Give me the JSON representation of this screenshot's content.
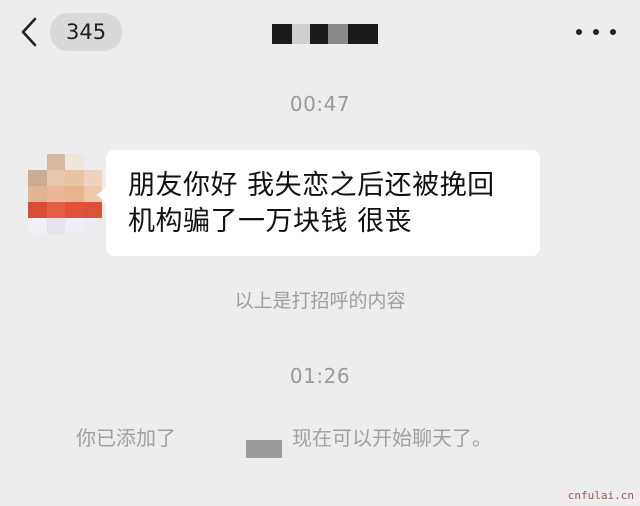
{
  "header": {
    "back_icon": "chevron-left-icon",
    "unread_count": "345",
    "title": "",
    "more_icon": "ellipsis-icon",
    "title_mosaic_colors": [
      "#1a1a1a",
      "#cfcfcf",
      "#1a1a1a",
      "#8a8a8a",
      "#1a1a1a"
    ]
  },
  "messages": [
    {
      "time": "00:47",
      "sender": "contact",
      "avatar_mosaic_colors": [
        "#ededed",
        "#d9b79a",
        "#f0e6dc",
        "#ededed",
        "#caa98c",
        "#e8c7a9",
        "#e9c2a1",
        "#f1d2bd",
        "#e1b38e",
        "#eab491",
        "#e8b08a",
        "#f0c6a6",
        "#d9452b",
        "#e2573d",
        "#e14a31",
        "#d94a2e",
        "#f3f1f6",
        "#e6e3ee",
        "#f2eef5",
        "#ececf2",
        "#ededed",
        "#ededed",
        "#ededed",
        "#ededed"
      ],
      "text_line1": "朋友你好 我失恋之后还被挽回",
      "text_line2": "机构骗了一万块钱 很丧"
    }
  ],
  "system": {
    "greeting_note": "以上是打招呼的内容",
    "time2": "01:26",
    "added_prefix": "你已添加了",
    "added_suffix": "现在可以开始聊天了。"
  },
  "watermark": "cnfulai.cn"
}
